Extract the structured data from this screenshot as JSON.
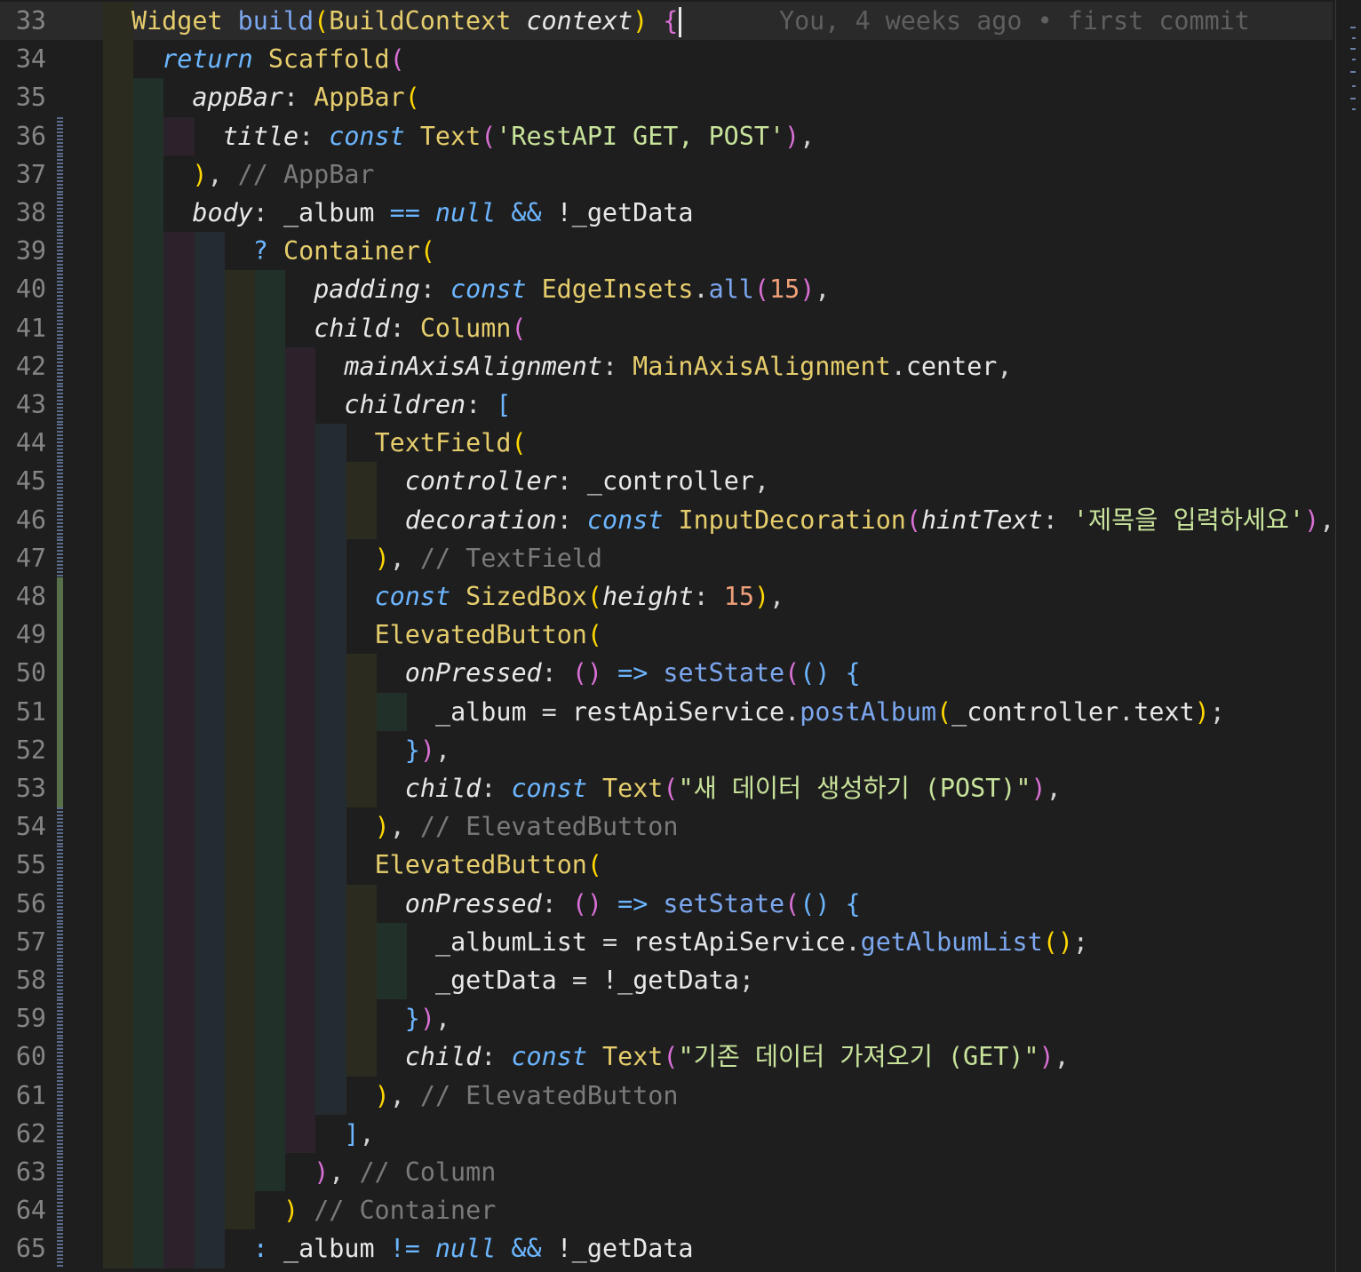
{
  "theme": {
    "background": "#1e1e1e",
    "line_number": "#858585",
    "blame": "#5f5f5f"
  },
  "blame": {
    "text": "You, 4 weeks ago • first commit"
  },
  "lines": [
    {
      "n": "33",
      "indent": 0,
      "gutter": "none",
      "tokens": [
        [
          "Widget",
          "#e6cd6c",
          0
        ],
        [
          " ",
          "#d4d4d4",
          0
        ],
        [
          "build",
          "#7ca7ef",
          0
        ],
        [
          "(",
          "#ffd700",
          0
        ],
        [
          "BuildContext",
          "#e6cd6c",
          0
        ],
        [
          " ",
          "#d4d4d4",
          0
        ],
        [
          "context",
          "#e8e8e8",
          1
        ],
        [
          ")",
          "#ffd700",
          0
        ],
        [
          " ",
          "#d4d4d4",
          0
        ],
        [
          "{",
          "#da70d6",
          0
        ]
      ]
    },
    {
      "n": "34",
      "indent": 1,
      "gutter": "none",
      "tokens": [
        [
          "return",
          "#6cb6ff",
          1
        ],
        [
          " ",
          "#d4d4d4",
          0
        ],
        [
          "Scaffold",
          "#e6cd6c",
          0
        ],
        [
          "(",
          "#da70d6",
          0
        ]
      ]
    },
    {
      "n": "35",
      "indent": 2,
      "gutter": "none",
      "tokens": [
        [
          "appBar",
          "#e8e8e8",
          1
        ],
        [
          ": ",
          "#d4d4d4",
          0
        ],
        [
          "AppBar",
          "#e6cd6c",
          0
        ],
        [
          "(",
          "#ffd700",
          0
        ]
      ]
    },
    {
      "n": "36",
      "indent": 3,
      "gutter": "mod",
      "tokens": [
        [
          "title",
          "#e8e8e8",
          1
        ],
        [
          ": ",
          "#d4d4d4",
          0
        ],
        [
          "const",
          "#6cb6ff",
          1
        ],
        [
          " ",
          "#d4d4d4",
          0
        ],
        [
          "Text",
          "#e6cd6c",
          0
        ],
        [
          "(",
          "#da70d6",
          0
        ],
        [
          "'RestAPI GET, POST'",
          "#c8e39b",
          0
        ],
        [
          ")",
          "#da70d6",
          0
        ],
        [
          ",",
          "#d4d4d4",
          0
        ]
      ]
    },
    {
      "n": "37",
      "indent": 2,
      "gutter": "mod",
      "tokens": [
        [
          ")",
          "#ffd700",
          0
        ],
        [
          ", ",
          "#d4d4d4",
          0
        ],
        [
          "// AppBar",
          "#7a7a7a",
          0
        ]
      ]
    },
    {
      "n": "38",
      "indent": 2,
      "gutter": "mod",
      "tokens": [
        [
          "body",
          "#e8e8e8",
          1
        ],
        [
          ": ",
          "#d4d4d4",
          0
        ],
        [
          "_album",
          "#e8e8e8",
          0
        ],
        [
          " ",
          "#d4d4d4",
          0
        ],
        [
          "==",
          "#6cb6ff",
          0
        ],
        [
          " ",
          "#d4d4d4",
          0
        ],
        [
          "null",
          "#6cb6ff",
          1
        ],
        [
          " ",
          "#d4d4d4",
          0
        ],
        [
          "&&",
          "#6cb6ff",
          0
        ],
        [
          " ",
          "#d4d4d4",
          0
        ],
        [
          "!_getData",
          "#e8e8e8",
          0
        ]
      ]
    },
    {
      "n": "39",
      "indent": 4,
      "gutter": "mod",
      "tokens": [
        [
          "? ",
          "#6cb6ff",
          0
        ],
        [
          "Container",
          "#e6cd6c",
          0
        ],
        [
          "(",
          "#ffd700",
          0
        ]
      ]
    },
    {
      "n": "40",
      "indent": 6,
      "gutter": "mod",
      "tokens": [
        [
          "padding",
          "#e8e8e8",
          1
        ],
        [
          ": ",
          "#d4d4d4",
          0
        ],
        [
          "const",
          "#6cb6ff",
          1
        ],
        [
          " ",
          "#d4d4d4",
          0
        ],
        [
          "EdgeInsets",
          "#e6cd6c",
          0
        ],
        [
          ".",
          "#d4d4d4",
          0
        ],
        [
          "all",
          "#7ca7ef",
          0
        ],
        [
          "(",
          "#da70d6",
          0
        ],
        [
          "15",
          "#f0a07a",
          0
        ],
        [
          ")",
          "#da70d6",
          0
        ],
        [
          ",",
          "#d4d4d4",
          0
        ]
      ]
    },
    {
      "n": "41",
      "indent": 6,
      "gutter": "mod",
      "tokens": [
        [
          "child",
          "#e8e8e8",
          1
        ],
        [
          ": ",
          "#d4d4d4",
          0
        ],
        [
          "Column",
          "#e6cd6c",
          0
        ],
        [
          "(",
          "#da70d6",
          0
        ]
      ]
    },
    {
      "n": "42",
      "indent": 7,
      "gutter": "mod",
      "tokens": [
        [
          "mainAxisAlignment",
          "#e8e8e8",
          1
        ],
        [
          ": ",
          "#d4d4d4",
          0
        ],
        [
          "MainAxisAlignment",
          "#e6cd6c",
          0
        ],
        [
          ".",
          "#d4d4d4",
          0
        ],
        [
          "center",
          "#e8e8e8",
          0
        ],
        [
          ",",
          "#d4d4d4",
          0
        ]
      ]
    },
    {
      "n": "43",
      "indent": 7,
      "gutter": "mod",
      "tokens": [
        [
          "children",
          "#e8e8e8",
          1
        ],
        [
          ": ",
          "#d4d4d4",
          0
        ],
        [
          "[",
          "#6cb6ff",
          0
        ]
      ]
    },
    {
      "n": "44",
      "indent": 8,
      "gutter": "mod",
      "tokens": [
        [
          "TextField",
          "#e6cd6c",
          0
        ],
        [
          "(",
          "#ffd700",
          0
        ]
      ]
    },
    {
      "n": "45",
      "indent": 9,
      "gutter": "mod",
      "tokens": [
        [
          "controller",
          "#e8e8e8",
          1
        ],
        [
          ": ",
          "#d4d4d4",
          0
        ],
        [
          "_controller",
          "#e8e8e8",
          0
        ],
        [
          ",",
          "#d4d4d4",
          0
        ]
      ]
    },
    {
      "n": "46",
      "indent": 9,
      "gutter": "mod",
      "tokens": [
        [
          "decoration",
          "#e8e8e8",
          1
        ],
        [
          ": ",
          "#d4d4d4",
          0
        ],
        [
          "const",
          "#6cb6ff",
          1
        ],
        [
          " ",
          "#d4d4d4",
          0
        ],
        [
          "InputDecoration",
          "#e6cd6c",
          0
        ],
        [
          "(",
          "#da70d6",
          0
        ],
        [
          "hintText",
          "#e8e8e8",
          1
        ],
        [
          ": ",
          "#d4d4d4",
          0
        ],
        [
          "'제목을 입력하세요'",
          "#c8e39b",
          0
        ],
        [
          ")",
          "#da70d6",
          0
        ],
        [
          ",",
          "#d4d4d4",
          0
        ]
      ]
    },
    {
      "n": "47",
      "indent": 8,
      "gutter": "mod",
      "tokens": [
        [
          ")",
          "#ffd700",
          0
        ],
        [
          ", ",
          "#d4d4d4",
          0
        ],
        [
          "// TextField",
          "#7a7a7a",
          0
        ]
      ]
    },
    {
      "n": "48",
      "indent": 8,
      "gutter": "add",
      "tokens": [
        [
          "const",
          "#6cb6ff",
          1
        ],
        [
          " ",
          "#d4d4d4",
          0
        ],
        [
          "SizedBox",
          "#e6cd6c",
          0
        ],
        [
          "(",
          "#ffd700",
          0
        ],
        [
          "height",
          "#e8e8e8",
          1
        ],
        [
          ": ",
          "#d4d4d4",
          0
        ],
        [
          "15",
          "#f0a07a",
          0
        ],
        [
          ")",
          "#ffd700",
          0
        ],
        [
          ",",
          "#d4d4d4",
          0
        ]
      ]
    },
    {
      "n": "49",
      "indent": 8,
      "gutter": "add",
      "tokens": [
        [
          "ElevatedButton",
          "#e6cd6c",
          0
        ],
        [
          "(",
          "#ffd700",
          0
        ]
      ]
    },
    {
      "n": "50",
      "indent": 9,
      "gutter": "add",
      "tokens": [
        [
          "onPressed",
          "#e8e8e8",
          1
        ],
        [
          ": ",
          "#d4d4d4",
          0
        ],
        [
          "()",
          "#da70d6",
          0
        ],
        [
          " ",
          "#d4d4d4",
          0
        ],
        [
          "=>",
          "#6cb6ff",
          0
        ],
        [
          " ",
          "#d4d4d4",
          0
        ],
        [
          "setState",
          "#7ca7ef",
          0
        ],
        [
          "(",
          "#da70d6",
          0
        ],
        [
          "()",
          "#6cb6ff",
          0
        ],
        [
          " ",
          "#d4d4d4",
          0
        ],
        [
          "{",
          "#6cb6ff",
          0
        ]
      ]
    },
    {
      "n": "51",
      "indent": 10,
      "gutter": "add",
      "tokens": [
        [
          "_album",
          "#e8e8e8",
          0
        ],
        [
          " = ",
          "#d4d4d4",
          0
        ],
        [
          "restApiService",
          "#e8e8e8",
          0
        ],
        [
          ".",
          "#d4d4d4",
          0
        ],
        [
          "postAlbum",
          "#7ca7ef",
          0
        ],
        [
          "(",
          "#ffd700",
          0
        ],
        [
          "_controller",
          "#e8e8e8",
          0
        ],
        [
          ".",
          "#d4d4d4",
          0
        ],
        [
          "text",
          "#e8e8e8",
          0
        ],
        [
          ")",
          "#ffd700",
          0
        ],
        [
          ";",
          "#d4d4d4",
          0
        ]
      ]
    },
    {
      "n": "52",
      "indent": 9,
      "gutter": "add",
      "tokens": [
        [
          "}",
          "#6cb6ff",
          0
        ],
        [
          ")",
          "#da70d6",
          0
        ],
        [
          ",",
          "#d4d4d4",
          0
        ]
      ]
    },
    {
      "n": "53",
      "indent": 9,
      "gutter": "add",
      "tokens": [
        [
          "child",
          "#e8e8e8",
          1
        ],
        [
          ": ",
          "#d4d4d4",
          0
        ],
        [
          "const",
          "#6cb6ff",
          1
        ],
        [
          " ",
          "#d4d4d4",
          0
        ],
        [
          "Text",
          "#e6cd6c",
          0
        ],
        [
          "(",
          "#da70d6",
          0
        ],
        [
          "\"새 데이터 생성하기 (POST)\"",
          "#c8e39b",
          0
        ],
        [
          ")",
          "#da70d6",
          0
        ],
        [
          ",",
          "#d4d4d4",
          0
        ]
      ]
    },
    {
      "n": "54",
      "indent": 8,
      "gutter": "mod",
      "tokens": [
        [
          ")",
          "#ffd700",
          0
        ],
        [
          ", ",
          "#d4d4d4",
          0
        ],
        [
          "// ElevatedButton",
          "#7a7a7a",
          0
        ]
      ]
    },
    {
      "n": "55",
      "indent": 8,
      "gutter": "mod",
      "tokens": [
        [
          "ElevatedButton",
          "#e6cd6c",
          0
        ],
        [
          "(",
          "#ffd700",
          0
        ]
      ]
    },
    {
      "n": "56",
      "indent": 9,
      "gutter": "mod",
      "tokens": [
        [
          "onPressed",
          "#e8e8e8",
          1
        ],
        [
          ": ",
          "#d4d4d4",
          0
        ],
        [
          "()",
          "#da70d6",
          0
        ],
        [
          " ",
          "#d4d4d4",
          0
        ],
        [
          "=>",
          "#6cb6ff",
          0
        ],
        [
          " ",
          "#d4d4d4",
          0
        ],
        [
          "setState",
          "#7ca7ef",
          0
        ],
        [
          "(",
          "#da70d6",
          0
        ],
        [
          "()",
          "#6cb6ff",
          0
        ],
        [
          " ",
          "#d4d4d4",
          0
        ],
        [
          "{",
          "#6cb6ff",
          0
        ]
      ]
    },
    {
      "n": "57",
      "indent": 10,
      "gutter": "mod",
      "tokens": [
        [
          "_albumList",
          "#e8e8e8",
          0
        ],
        [
          " = ",
          "#d4d4d4",
          0
        ],
        [
          "restApiService",
          "#e8e8e8",
          0
        ],
        [
          ".",
          "#d4d4d4",
          0
        ],
        [
          "getAlbumList",
          "#7ca7ef",
          0
        ],
        [
          "()",
          "#ffd700",
          0
        ],
        [
          ";",
          "#d4d4d4",
          0
        ]
      ]
    },
    {
      "n": "58",
      "indent": 10,
      "gutter": "mod",
      "tokens": [
        [
          "_getData",
          "#e8e8e8",
          0
        ],
        [
          " = ",
          "#d4d4d4",
          0
        ],
        [
          "!_getData",
          "#e8e8e8",
          0
        ],
        [
          ";",
          "#d4d4d4",
          0
        ]
      ]
    },
    {
      "n": "59",
      "indent": 9,
      "gutter": "mod",
      "tokens": [
        [
          "}",
          "#6cb6ff",
          0
        ],
        [
          ")",
          "#da70d6",
          0
        ],
        [
          ",",
          "#d4d4d4",
          0
        ]
      ]
    },
    {
      "n": "60",
      "indent": 9,
      "gutter": "mod",
      "tokens": [
        [
          "child",
          "#e8e8e8",
          1
        ],
        [
          ": ",
          "#d4d4d4",
          0
        ],
        [
          "const",
          "#6cb6ff",
          1
        ],
        [
          " ",
          "#d4d4d4",
          0
        ],
        [
          "Text",
          "#e6cd6c",
          0
        ],
        [
          "(",
          "#da70d6",
          0
        ],
        [
          "\"기존 데이터 가져오기 (GET)\"",
          "#c8e39b",
          0
        ],
        [
          ")",
          "#da70d6",
          0
        ],
        [
          ",",
          "#d4d4d4",
          0
        ]
      ]
    },
    {
      "n": "61",
      "indent": 8,
      "gutter": "mod",
      "tokens": [
        [
          ")",
          "#ffd700",
          0
        ],
        [
          ", ",
          "#d4d4d4",
          0
        ],
        [
          "// ElevatedButton",
          "#7a7a7a",
          0
        ]
      ]
    },
    {
      "n": "62",
      "indent": 7,
      "gutter": "mod",
      "tokens": [
        [
          "]",
          "#6cb6ff",
          0
        ],
        [
          ",",
          "#d4d4d4",
          0
        ]
      ]
    },
    {
      "n": "63",
      "indent": 6,
      "gutter": "mod",
      "tokens": [
        [
          ")",
          "#da70d6",
          0
        ],
        [
          ", ",
          "#d4d4d4",
          0
        ],
        [
          "// Column",
          "#7a7a7a",
          0
        ]
      ]
    },
    {
      "n": "64",
      "indent": 5,
      "gutter": "mod",
      "tokens": [
        [
          ")",
          "#ffd700",
          0
        ],
        [
          " ",
          "#d4d4d4",
          0
        ],
        [
          "// Container",
          "#7a7a7a",
          0
        ]
      ]
    },
    {
      "n": "65",
      "indent": 4,
      "gutter": "mod",
      "tokens": [
        [
          ": ",
          "#6cb6ff",
          0
        ],
        [
          "_album",
          "#e8e8e8",
          0
        ],
        [
          " ",
          "#d4d4d4",
          0
        ],
        [
          "!=",
          "#6cb6ff",
          0
        ],
        [
          " ",
          "#d4d4d4",
          0
        ],
        [
          "null",
          "#6cb6ff",
          1
        ],
        [
          " ",
          "#d4d4d4",
          0
        ],
        [
          "&&",
          "#6cb6ff",
          0
        ],
        [
          " ",
          "#d4d4d4",
          0
        ],
        [
          "!_getData",
          "#e8e8e8",
          0
        ]
      ]
    }
  ]
}
